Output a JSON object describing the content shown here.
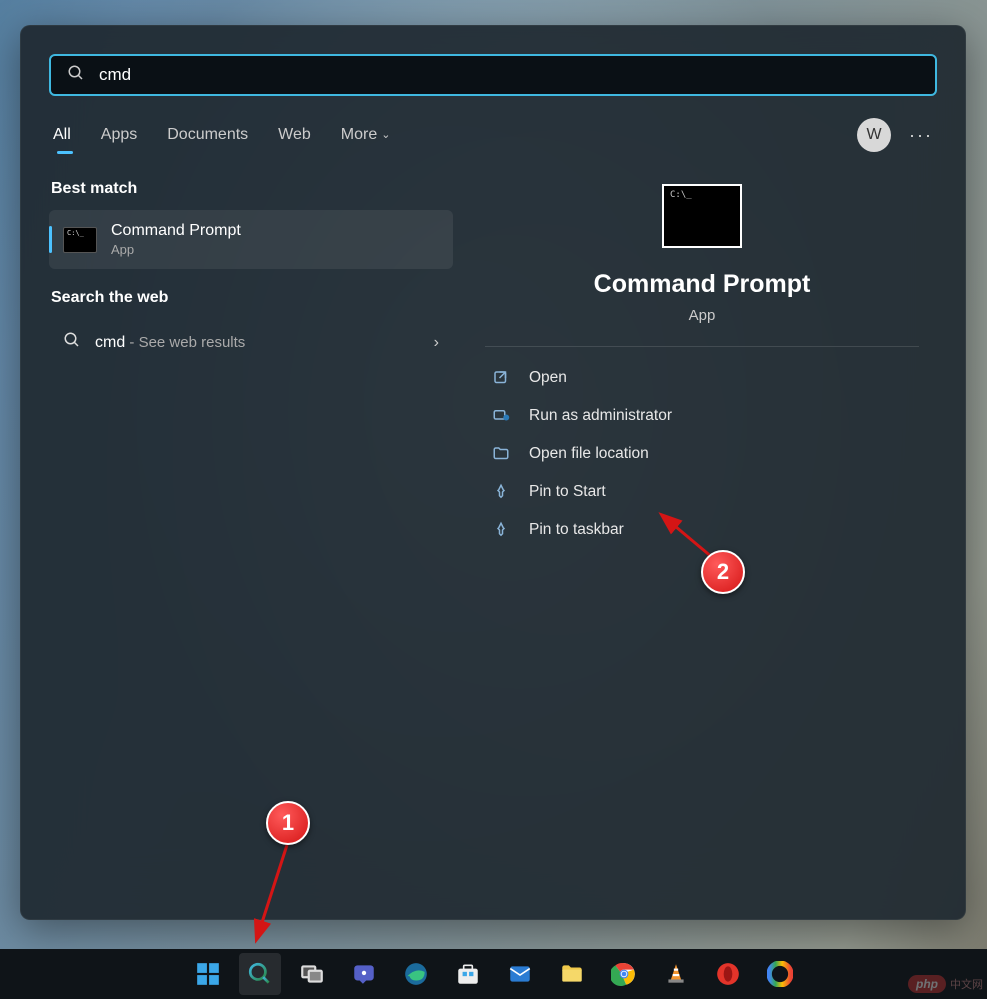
{
  "search": {
    "value": "cmd"
  },
  "tabs": {
    "items": [
      "All",
      "Apps",
      "Documents",
      "Web",
      "More"
    ],
    "active": 0
  },
  "avatar_initial": "W",
  "results": {
    "best_match_header": "Best match",
    "best_match": {
      "title": "Command Prompt",
      "subtitle": "App"
    },
    "web_header": "Search the web",
    "web_item": {
      "query": "cmd",
      "suffix": " - See web results"
    }
  },
  "preview": {
    "title": "Command Prompt",
    "subtitle": "App",
    "actions": [
      {
        "icon": "open-icon",
        "label": "Open"
      },
      {
        "icon": "admin-icon",
        "label": "Run as administrator"
      },
      {
        "icon": "folder-icon",
        "label": "Open file location"
      },
      {
        "icon": "pin-start-icon",
        "label": "Pin to Start"
      },
      {
        "icon": "pin-taskbar-icon",
        "label": "Pin to taskbar"
      }
    ]
  },
  "taskbar": {
    "items": [
      {
        "name": "start-button",
        "glyph": "start"
      },
      {
        "name": "search-button",
        "glyph": "search",
        "active": true
      },
      {
        "name": "task-view-button",
        "glyph": "taskview"
      },
      {
        "name": "chat-button",
        "glyph": "chat"
      },
      {
        "name": "edge-button",
        "glyph": "edge"
      },
      {
        "name": "store-button",
        "glyph": "store"
      },
      {
        "name": "mail-button",
        "glyph": "mail"
      },
      {
        "name": "explorer-button",
        "glyph": "folder"
      },
      {
        "name": "chrome-button",
        "glyph": "chrome"
      },
      {
        "name": "vlc-button",
        "glyph": "vlc"
      },
      {
        "name": "opera-button",
        "glyph": "opera"
      },
      {
        "name": "browser-button",
        "glyph": "globe"
      }
    ]
  },
  "annotations": {
    "a1": "1",
    "a2": "2"
  },
  "watermark": {
    "brand": "php",
    "text": "中文网"
  }
}
